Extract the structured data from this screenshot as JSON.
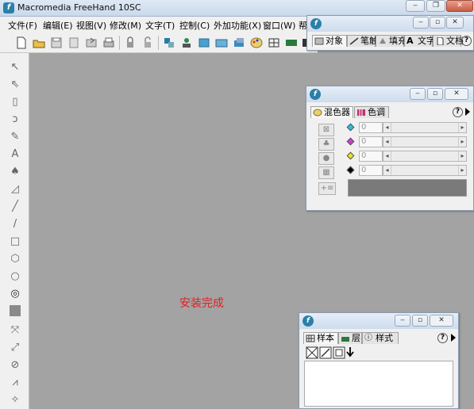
{
  "window": {
    "title": "Macromedia FreeHand 10SC"
  },
  "menu": {
    "items": [
      "文件(F)",
      "编辑(E)",
      "视图(V)",
      "修改(M)",
      "文字(T)",
      "控制(C)",
      "外加功能(X)",
      "窗口(W)",
      "帮"
    ]
  },
  "canvas": {
    "message": "安装完成"
  },
  "object_panel": {
    "tabs": [
      "对象",
      "笔触",
      "填充",
      "文字",
      "文档"
    ]
  },
  "mixer_panel": {
    "tabs": [
      "混色器",
      "色调"
    ],
    "values": [
      "0",
      "0",
      "0",
      "0"
    ],
    "swatch_color": "#7a7a7a",
    "channel_colors": [
      "#27c1e8",
      "#d23ad8",
      "#f0e020",
      "#000000"
    ]
  },
  "swatches_panel": {
    "tabs": [
      "样本",
      "层",
      "样式"
    ]
  },
  "colors": {
    "workspace": "#a3a3a3",
    "chrome": "#f0f0f0",
    "status_text": "#e02020"
  },
  "icons": {
    "app": "freehand-icon",
    "help": "help-icon",
    "menu_arrow": "right-arrow-icon"
  }
}
